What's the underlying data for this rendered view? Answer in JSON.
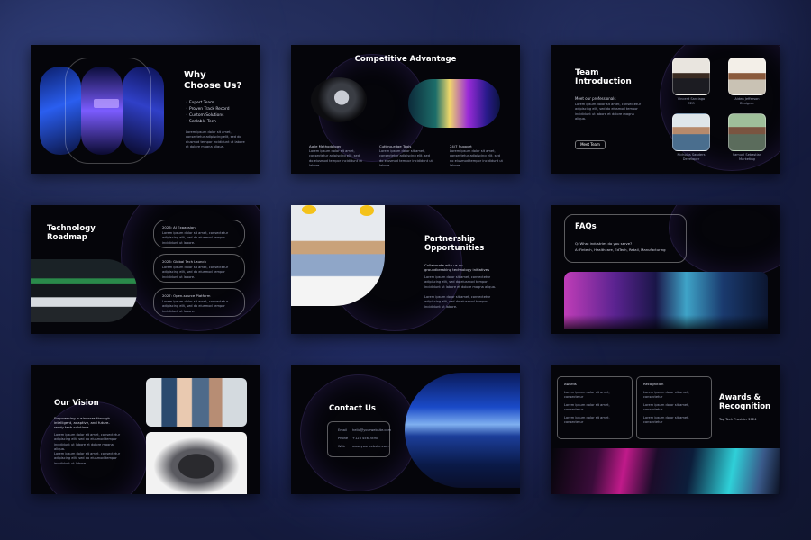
{
  "slide1": {
    "title_line1": "Why",
    "title_line2": "Choose Us?",
    "bullets": [
      "Expert Team",
      "Proven Track Record",
      "Custom Solutions",
      "Scalable Tech"
    ],
    "body": "Lorem ipsum dolor sit amet, consectetur adipiscing elit, sed do eiusmod tempor incididunt ut labore et dolore magna aliqua."
  },
  "slide2": {
    "title": "Competitive Advantage",
    "cols": [
      {
        "head": "Agile Methodology",
        "body": "Lorem ipsum dolor sit amet, consectetur adipiscing elit, sed do eiusmod tempor incididunt ut labore."
      },
      {
        "head": "Cutting-edge Tools",
        "body": "Lorem ipsum dolor sit amet, consectetur adipiscing elit, sed do eiusmod tempor incididunt ut labore."
      },
      {
        "head": "24/7 Support",
        "body": "Lorem ipsum dolor sit amet, consectetur adipiscing elit, sed do eiusmod tempor incididunt ut labore."
      }
    ]
  },
  "slide3": {
    "title_line1": "Team",
    "title_line2": "Introduction",
    "subtitle": "Meet our professionals",
    "body": "Lorem ipsum dolor sit amet, consectetur adipiscing elit, sed do eiusmod tempor incididunt ut labore et dolore magna aliqua.",
    "button": "Meet Team",
    "members": [
      {
        "name": "Vincent Santiago",
        "role": "CEO"
      },
      {
        "name": "Aiden Jefferson",
        "role": "Designer"
      },
      {
        "name": "Nicholas Sanders",
        "role": "Developer"
      },
      {
        "name": "Samuel Sebastian",
        "role": "Marketing"
      }
    ]
  },
  "slide4": {
    "title_line1": "Technology",
    "title_line2": "Roadmap",
    "items": [
      {
        "head": "2026: AI Expansion",
        "body": "Lorem ipsum dolor sit amet, consectetur adipiscing elit, sed do eiusmod tempor incididunt ut labore."
      },
      {
        "head": "2026: Global Tech Launch",
        "body": "Lorem ipsum dolor sit amet, consectetur adipiscing elit, sed do eiusmod tempor incididunt ut labore."
      },
      {
        "head": "2027: Open-source Platform",
        "body": "Lorem ipsum dolor sit amet, consectetur adipiscing elit, sed do eiusmod tempor incididunt ut labore."
      }
    ]
  },
  "slide5": {
    "title_line1": "Partnership",
    "title_line2": "Opportunities",
    "subtitle1": "Collaborate with us on",
    "subtitle2": "groundbreaking technology initiatives",
    "body1": "Lorem ipsum dolor sit amet, consectetur adipiscing elit, sed do eiusmod tempor incididunt ut labore et dolore magna aliqua.",
    "body2": "Lorem ipsum dolor sit amet, consectetur adipiscing elit, sed do eiusmod tempor incididunt ut labore."
  },
  "slide6": {
    "title": "FAQs",
    "question": "Q: What industries do you serve?",
    "answer": "A: Fintech, Healthcare, EdTech, Retail, Manufacturing"
  },
  "slide7": {
    "title": "Our Vision",
    "subtitle1": "Empowering businesses through",
    "subtitle2": "intelligent, adaptive, and future-",
    "subtitle3": "ready tech solutions",
    "body1": "Lorem ipsum dolor sit amet, consectetur adipiscing elit, sed do eiusmod tempor incididunt ut labore et dolore magna aliqua.",
    "body2": "Lorem ipsum dolor sit amet, consectetur adipiscing elit, sed do eiusmod tempor incididunt ut labore."
  },
  "slide8": {
    "title": "Contact Us",
    "rows": [
      {
        "label": "Email",
        "value": "hello@yourwebsite.com"
      },
      {
        "label": "Phone",
        "value": "+123 456 7890"
      },
      {
        "label": "Web",
        "value": "www.yourwebsite.com"
      }
    ]
  },
  "slide9": {
    "title_line1": "Awards &",
    "title_line2": "Recognition",
    "subtitle": "Top Tech Provider 2024",
    "box1": {
      "head": "Awards",
      "items": [
        "Lorem ipsum dolor sit amet, consectetur",
        "Lorem ipsum dolor sit amet, consectetur",
        "Lorem ipsum dolor sit amet, consectetur"
      ]
    },
    "box2": {
      "head": "Recognition",
      "items": [
        "Lorem ipsum dolor sit amet, consectetur",
        "Lorem ipsum dolor sit amet, consectetur",
        "Lorem ipsum dolor sit amet, consectetur"
      ]
    }
  }
}
